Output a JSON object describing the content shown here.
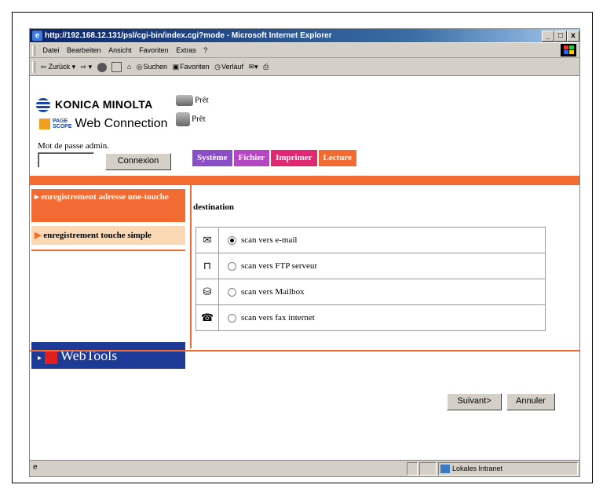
{
  "window": {
    "title": "http://192.168.12.131/psl/cgi-bin/index.cgi?mode - Microsoft Internet Explorer",
    "minimize": "_",
    "maximize": "□",
    "close": "x"
  },
  "menu": [
    "Datei",
    "Bearbeiten",
    "Ansicht",
    "Favoriten",
    "Extras",
    "?"
  ],
  "toolbar": {
    "back": "⇦ Zurück ▾",
    "forward": "⇨ ▾",
    "search": "Suchen",
    "favorites": "Favoriten",
    "history": "Verlauf"
  },
  "header": {
    "brand": "KONICA MINOLTA",
    "pagescope_small_1": "PAGE",
    "pagescope_small_2": "SCOPE",
    "product": "Web Connection",
    "status_printer": "Prêt",
    "status_scanner": "Prêt",
    "password_label": "Mot de passe admin.",
    "login_button": "Connexion"
  },
  "tabs": [
    {
      "label": "Système",
      "color": "#8a4ec7"
    },
    {
      "label": "Fichier",
      "color": "#b547c2"
    },
    {
      "label": "Imprimer",
      "color": "#e02870"
    },
    {
      "label": "Lecture",
      "color": "#f26b33"
    }
  ],
  "sidebar": {
    "items": [
      {
        "label": "enregistrement adresse une-touche"
      },
      {
        "label": "enregistrement touche simple"
      }
    ],
    "webtools": "WebTools"
  },
  "main": {
    "heading": "destination",
    "options": [
      {
        "icon": "✉",
        "icon_name": "email-icon",
        "label": "scan vers e-mail",
        "selected": true
      },
      {
        "icon": "🖳",
        "icon_name": "ftp-server-icon",
        "label": "scan vers FTP serveur",
        "selected": false
      },
      {
        "icon": "⛁",
        "icon_name": "mailbox-icon",
        "label": "scan vers Mailbox",
        "selected": false
      },
      {
        "icon": "☎",
        "icon_name": "internet-fax-icon",
        "label": "scan vers fax internet",
        "selected": false
      }
    ],
    "next_button": "Suivant>",
    "cancel_button": "Annuler"
  },
  "statusbar": {
    "zone": "Lokales Intranet"
  },
  "colors": {
    "accent": "#f26b33",
    "accent_light": "#fcd9b5",
    "webtools_bg": "#1d3b96"
  }
}
